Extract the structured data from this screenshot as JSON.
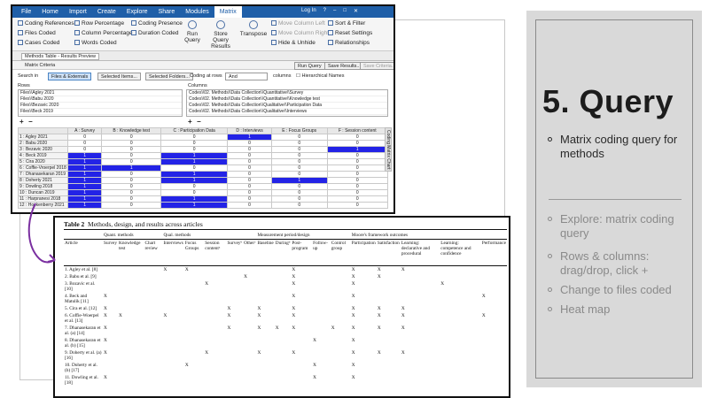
{
  "slide": {
    "title": "5. Query",
    "bullets_main": [
      "Matrix coding query for methods"
    ],
    "bullets_sub": [
      "Explore: matrix coding query",
      "Rows & columns: drag/drop, click +",
      "Change to files coded",
      "Heat map"
    ]
  },
  "nvivo": {
    "menus": [
      "File",
      "Home",
      "Import",
      "Create",
      "Explore",
      "Share",
      "Modules",
      "Matrix"
    ],
    "active_menu": "Matrix",
    "window_controls": [
      "Log In",
      "?",
      "–",
      "□",
      "✕"
    ],
    "ribbon": {
      "col1": [
        "Coding References",
        "Files Coded",
        "Cases Coded"
      ],
      "col2": [
        "Row Percentage",
        "Column Percentage",
        "Words Coded"
      ],
      "col3": [
        "Coding Presence",
        "Duration Coded"
      ],
      "run_query": "Run Query",
      "store_results": "Store Query Results",
      "transpose": "Transpose",
      "col4": [
        "Move Column Left",
        "Move Column Right",
        "Hide & Unhide"
      ],
      "col5": [
        "Sort & Filter",
        "Reset Settings",
        "Relationships"
      ]
    },
    "tab_label": "Methods Table - Results Preview",
    "criteria_label": "Matrix Criteria",
    "search_in": "Search in",
    "files_externals": "Files & Externals",
    "selected_items": "Selected Items...",
    "selected_folders": "Selected Folders...",
    "coding_at_rows": "Coding at rows",
    "and_value": "And",
    "columns_label": "columns",
    "hierarchical_names": "Hierarchical Names",
    "run_query_btn": "Run Query",
    "save_results_btn": "Save Results...",
    "save_criteria_btn": "Save Criteria...",
    "rows_label": "Rows",
    "columns_header": "Columns",
    "row_items": [
      "Files\\\\Agley 2021",
      "Files\\\\Babu 2020",
      "Files\\\\Bezavic 2020",
      "Files\\\\Beck 2019"
    ],
    "column_items": [
      "Codes\\\\02. Methods\\\\Data Collection\\\\Quantitative\\\\Survey",
      "Codes\\\\02. Methods\\\\Data Collection\\\\Quantitative\\\\Knowledge test",
      "Codes\\\\02. Methods\\\\Data Collection\\\\Qualitative\\\\Participation Data",
      "Codes\\\\02. Methods\\\\Data Collection\\\\Qualitative\\\\Interviews"
    ],
    "side_tab": "Coding Matrix Chart",
    "grid": {
      "columns": [
        "A : Survey",
        "B : Knowledge test",
        "C : Participation Data",
        "D : Interviews",
        "E : Focus Groups",
        "F : Session content"
      ],
      "rows": [
        {
          "label": "1 : Agley 2021",
          "values": [
            "0",
            "0",
            "0",
            "1",
            "0",
            "0"
          ]
        },
        {
          "label": "2 : Babu 2020",
          "values": [
            "0",
            "0",
            "0",
            "0",
            "0",
            "0"
          ]
        },
        {
          "label": "3 : Bezavic 2020",
          "values": [
            "0",
            "0",
            "0",
            "0",
            "0",
            "1"
          ]
        },
        {
          "label": "4 : Beck 2019",
          "values": [
            "1",
            "0",
            "1",
            "0",
            "0",
            "0"
          ]
        },
        {
          "label": "5 : Cira 2020",
          "values": [
            "1",
            "0",
            "1",
            "0",
            "0",
            "0"
          ]
        },
        {
          "label": "6 : Coffie-Vroerpel 2018",
          "values": [
            "1",
            "1",
            "0",
            "0",
            "0",
            "0"
          ]
        },
        {
          "label": "7 : Dhanasekaran 2019",
          "values": [
            "1",
            "0",
            "1",
            "0",
            "0",
            "0"
          ]
        },
        {
          "label": "8 : Doherty 2021",
          "values": [
            "1",
            "0",
            "1",
            "0",
            "1",
            "0"
          ]
        },
        {
          "label": "9 : Dowling 2018",
          "values": [
            "1",
            "0",
            "0",
            "0",
            "0",
            "0"
          ]
        },
        {
          "label": "10 : Duncan 2019",
          "values": [
            "1",
            "0",
            "0",
            "0",
            "0",
            "0"
          ]
        },
        {
          "label": "11 : Harpranesi 2018",
          "values": [
            "1",
            "0",
            "1",
            "0",
            "0",
            "0"
          ]
        },
        {
          "label": "12 : Hockenberry 2021",
          "values": [
            "1",
            "0",
            "1",
            "0",
            "0",
            "0"
          ]
        }
      ]
    }
  },
  "table2": {
    "caption_bold": "Table 2",
    "caption_rest": "Methods, design, and results across articles",
    "groups": [
      "Quant. methods",
      "Qual. methods",
      "Measurement period/design",
      "Moore's framework outcomes"
    ],
    "headers": [
      "Article",
      "Survey",
      "Knowledge test",
      "Chart review",
      "Interviews",
      "Focus Groups",
      "Session contentᵃ",
      "Surveyᵇ",
      "Otherᶜ",
      "Baseline",
      "Duringᵈ",
      "Post-program",
      "Follow-up",
      "Control group",
      "Participation",
      "Satisfaction",
      "Learning: declarative and procedural",
      "Learning: competence and confidence",
      "Performance"
    ],
    "rows": [
      {
        "article": "1. Agley et al. [8]",
        "marks": [
          "",
          "",
          "",
          "X",
          "X",
          "",
          "",
          "",
          "",
          "",
          "X",
          "",
          "",
          "X",
          "X",
          "X",
          "",
          ""
        ]
      },
      {
        "article": "2. Babu et al. [9]",
        "marks": [
          "",
          "",
          "",
          "",
          "",
          "",
          "",
          "X",
          "",
          "",
          "X",
          "",
          "",
          "X",
          "X",
          "",
          "",
          ""
        ]
      },
      {
        "article": "3. Bozavic et al. [10]",
        "marks": [
          "",
          "",
          "",
          "",
          "",
          "X",
          "",
          "",
          "",
          "",
          "X",
          "",
          "",
          "X",
          "",
          "",
          "X",
          ""
        ]
      },
      {
        "article": "4. Beck and Matulik [11]",
        "marks": [
          "X",
          "",
          "",
          "",
          "",
          "",
          "",
          "",
          "",
          "",
          "X",
          "",
          "",
          "X",
          "",
          "",
          "",
          "X"
        ]
      },
      {
        "article": "5. Cira et al. [12]",
        "marks": [
          "X",
          "",
          "",
          "",
          "",
          "",
          "X",
          "",
          "X",
          "",
          "X",
          "",
          "",
          "X",
          "X",
          "X",
          "",
          ""
        ]
      },
      {
        "article": "6. Coffie-Woerpel et al. [13]",
        "marks": [
          "X",
          "X",
          "",
          "X",
          "",
          "",
          "X",
          "",
          "X",
          "",
          "X",
          "",
          "",
          "X",
          "X",
          "X",
          "",
          "X"
        ]
      },
      {
        "article": "7. Dhanasekaran et al. (a) [14]",
        "marks": [
          "X",
          "",
          "",
          "",
          "",
          "",
          "X",
          "",
          "X",
          "X",
          "X",
          "",
          "X",
          "X",
          "X",
          "X",
          "",
          ""
        ]
      },
      {
        "article": "8. Dhanasekaran et al. (b) [15]",
        "marks": [
          "X",
          "",
          "",
          "",
          "",
          "",
          "",
          "",
          "",
          "",
          "",
          "X",
          "",
          "X",
          "",
          "",
          "",
          ""
        ]
      },
      {
        "article": "9. Doherty et al. (a) [16]",
        "marks": [
          "X",
          "",
          "",
          "",
          "",
          "X",
          "",
          "",
          "X",
          "",
          "X",
          "",
          "",
          "X",
          "X",
          "X",
          "",
          ""
        ]
      },
      {
        "article": "10. Doherty et al. (b) [17]",
        "marks": [
          "",
          "",
          "",
          "",
          "X",
          "",
          "",
          "",
          "",
          "",
          "",
          "X",
          "",
          "X",
          "",
          "",
          "",
          ""
        ]
      },
      {
        "article": "11. Dowling et al. [18]",
        "marks": [
          "X",
          "",
          "",
          "",
          "",
          "",
          "",
          "",
          "",
          "",
          "",
          "X",
          "",
          "X",
          "",
          "",
          "",
          ""
        ]
      }
    ]
  }
}
